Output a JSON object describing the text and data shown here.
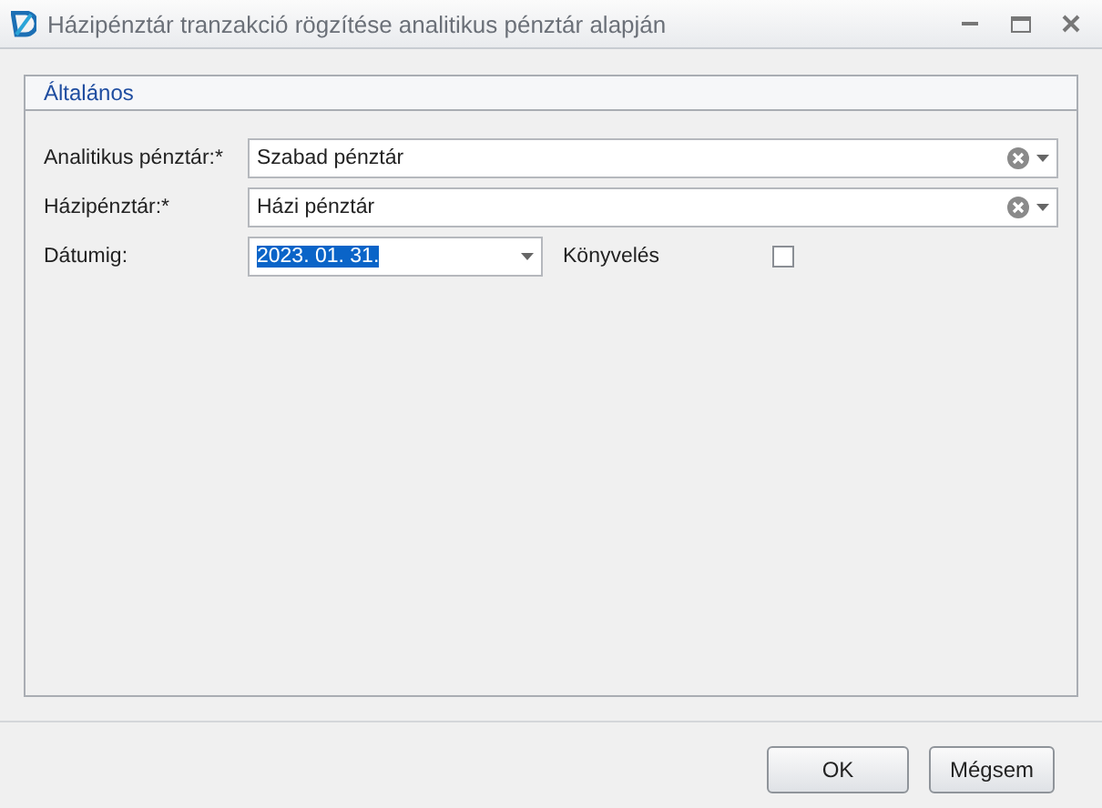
{
  "window": {
    "title": "Házipénztár tranzakció rögzítése analitikus pénztár alapján"
  },
  "group": {
    "title": "Általános"
  },
  "fields": [
    {
      "label": "Analitikus pénztár:*",
      "value": "Szabad pénztár",
      "kind": "combo"
    },
    {
      "label": "Házipénztár:*",
      "value": "Házi pénztár",
      "kind": "combo"
    },
    {
      "label": "Dátumig:",
      "value": "2023. 01. 31.",
      "kind": "date",
      "selected": true
    }
  ],
  "checkbox": {
    "label": "Könyvelés",
    "checked": false
  },
  "buttons": [
    "OK",
    "Mégsem"
  ]
}
